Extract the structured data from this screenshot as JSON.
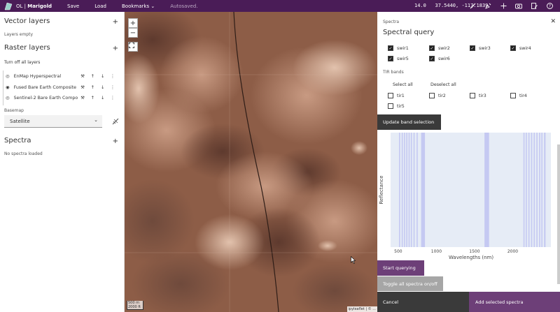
{
  "topbar": {
    "brand_prefix": "OL",
    "brand_name": "Marigold",
    "menu": [
      "Save",
      "Load",
      "Bookmarks"
    ],
    "status": "Autosaved.",
    "zoom": "14.0",
    "coords": "37.5440, -117.1839"
  },
  "left": {
    "vector_title": "Vector layers",
    "layers_empty": "Layers empty",
    "raster_title": "Raster layers",
    "turn_off_all": "Turn off all layers",
    "layers": [
      {
        "name": "EnMap Hyperspectral"
      },
      {
        "name": "Fused Bare Earth Composite"
      },
      {
        "name": "Sentinel-2 Bare Earth Compo..."
      }
    ],
    "basemap_label": "Basemap",
    "basemap_value": "Satellite",
    "spectra_title": "Spectra",
    "no_spectra": "No spectra loaded"
  },
  "map": {
    "zoom_in": "+",
    "zoom_out": "−",
    "scale_m": "500 m",
    "scale_ft": "2000 ft",
    "attribution": "ipyleaflet | © ..."
  },
  "right": {
    "header": "Spectra",
    "title": "Spectral query",
    "swir": [
      {
        "label": "swir1",
        "checked": true
      },
      {
        "label": "swir2",
        "checked": true
      },
      {
        "label": "swir3",
        "checked": true
      },
      {
        "label": "swir4",
        "checked": true
      },
      {
        "label": "swir5",
        "checked": true
      },
      {
        "label": "swir6",
        "checked": true
      }
    ],
    "tir_label": "TIR bands",
    "select_all": "Select all",
    "deselect_all": "Deselect all",
    "tir": [
      {
        "label": "tir1",
        "checked": false
      },
      {
        "label": "tir2",
        "checked": false
      },
      {
        "label": "tir3",
        "checked": false
      },
      {
        "label": "tir4",
        "checked": false
      },
      {
        "label": "tir5",
        "checked": false
      }
    ],
    "update_button": "Update band selection",
    "start_button": "Start querying",
    "toggle_button": "Toggle all spectra on/off",
    "cancel_button": "Cancel",
    "add_button": "Add selected spectra"
  },
  "chart_data": {
    "type": "bar",
    "xlabel": "Wavelengths (nm)",
    "ylabel": "Reflectance",
    "xlim": [
      400,
      2500
    ],
    "xticks": [
      500,
      1000,
      1500,
      2000
    ],
    "highlight_color": "#c5c9f2",
    "background_color": "#e6ecf6",
    "bands": [
      [
        510,
        525
      ],
      [
        545,
        560
      ],
      [
        575,
        590
      ],
      [
        605,
        620
      ],
      [
        635,
        650
      ],
      [
        665,
        680
      ],
      [
        700,
        715
      ],
      [
        740,
        755
      ],
      [
        800,
        850
      ],
      [
        1630,
        1690
      ],
      [
        2140,
        2155
      ],
      [
        2170,
        2185
      ],
      [
        2205,
        2220
      ],
      [
        2240,
        2255
      ],
      [
        2275,
        2290
      ],
      [
        2310,
        2325
      ],
      [
        2345,
        2360
      ],
      [
        2375,
        2390
      ],
      [
        2410,
        2430
      ]
    ]
  }
}
